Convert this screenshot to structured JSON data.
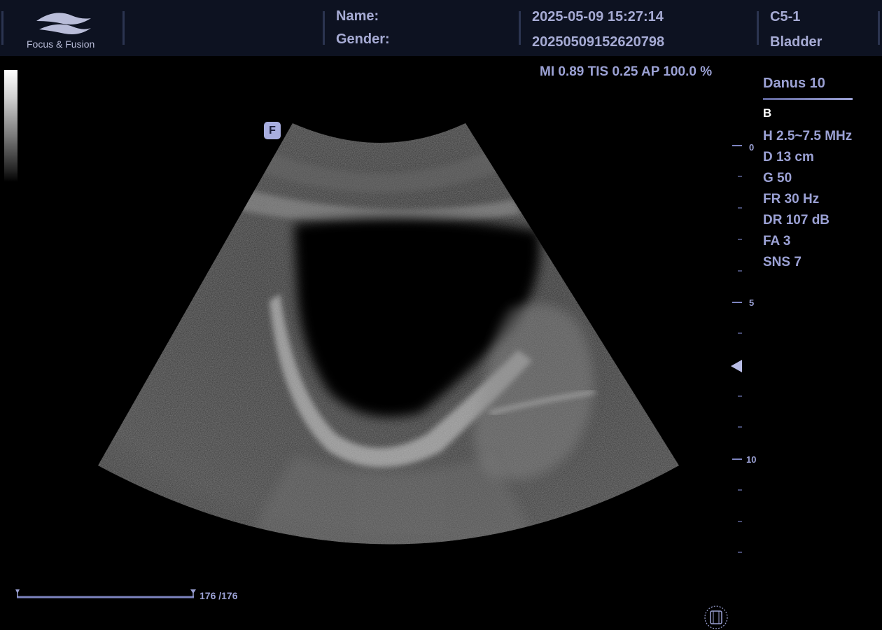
{
  "header": {
    "logo_text": "Focus & Fusion",
    "name_label": "Name:",
    "gender_label": "Gender:",
    "datetime": "2025-05-09  15:27:14",
    "exam_id": "20250509152620798",
    "probe": "C5-1",
    "preset": "Bladder"
  },
  "acoustic": {
    "readout": "MI 0.89  TIS 0.25  AP 100.0 %"
  },
  "params": {
    "device": "Danus 10",
    "mode": "B",
    "items": [
      "H 2.5~7.5 MHz",
      "D 13 cm",
      "G 50",
      "FR 30 Hz",
      "DR 107 dB",
      "FA 3",
      "SNS 7"
    ]
  },
  "scale": {
    "labels": [
      "0",
      "5",
      "10"
    ]
  },
  "focus_marker": "F",
  "cine": {
    "counter": "176 /176"
  },
  "colors": {
    "accent": "#8f95c8",
    "topbar": "#0d1221",
    "separator": "#2b3450"
  }
}
